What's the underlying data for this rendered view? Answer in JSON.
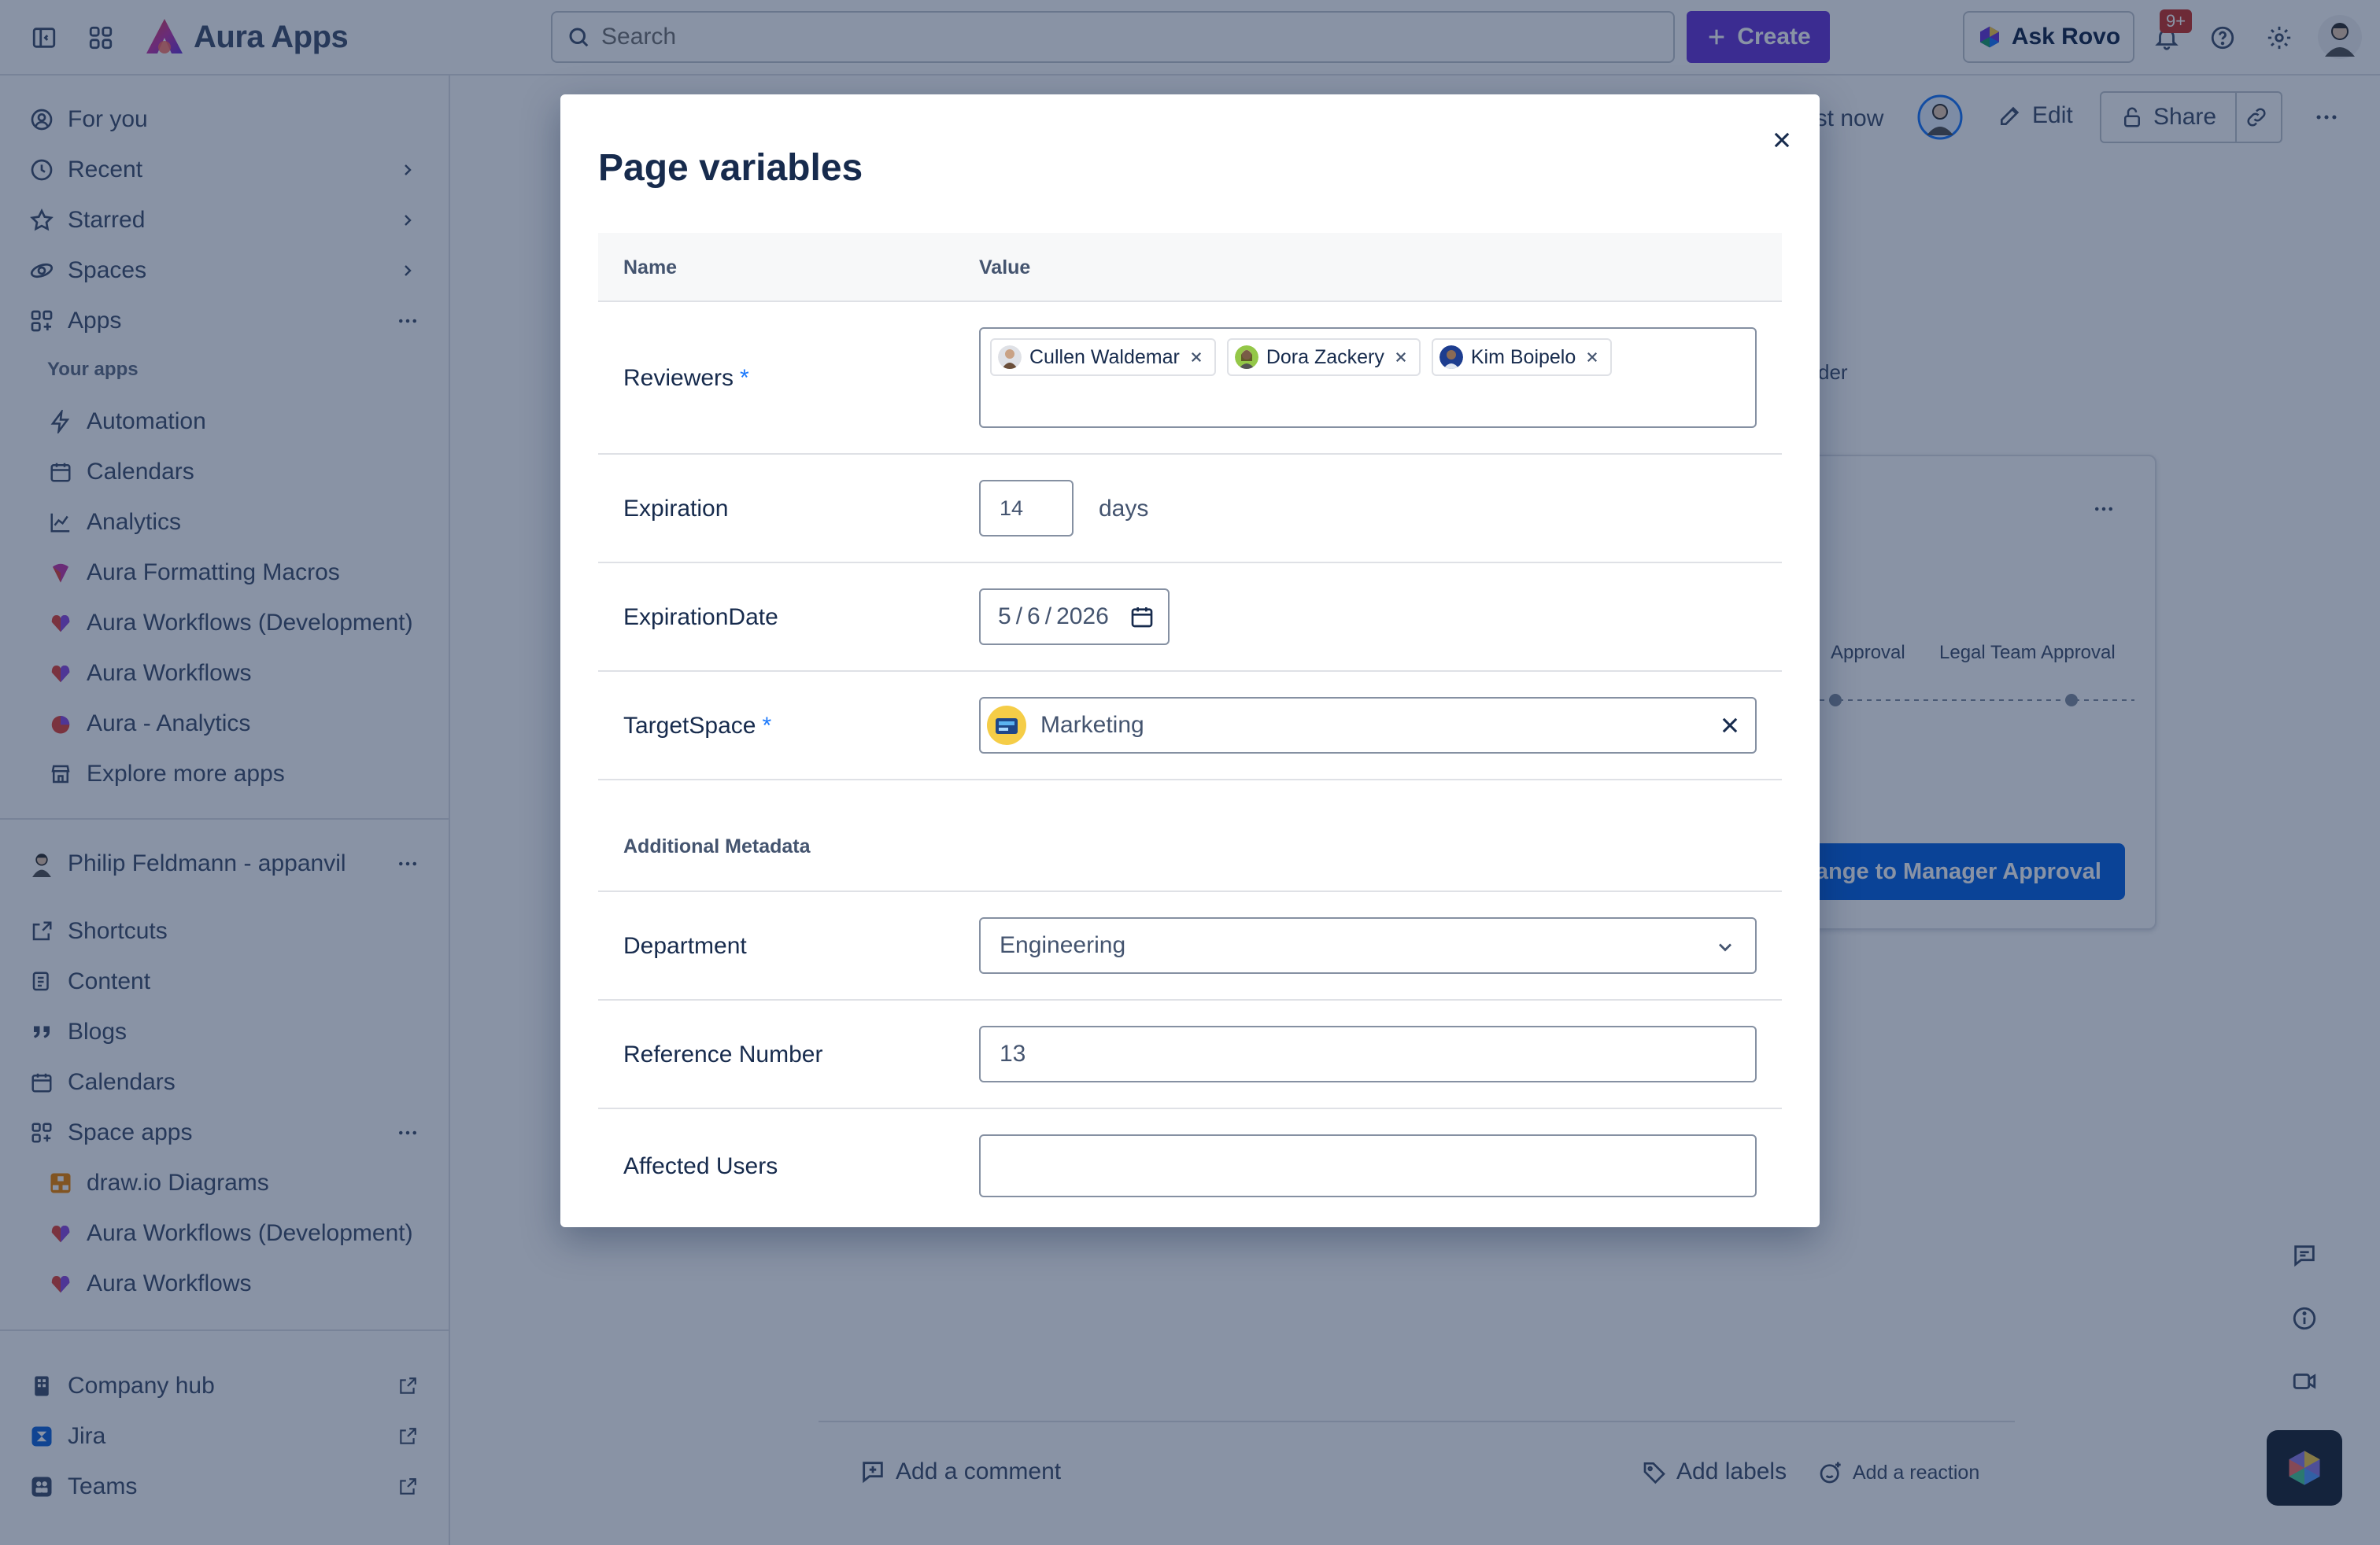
{
  "topbar": {
    "app_name": "Aura Apps",
    "search_placeholder": "Search",
    "create_label": "Create",
    "ask_rovo_label": "Ask Rovo",
    "notifications_badge": "9+"
  },
  "sidebar": {
    "top_items": [
      {
        "label": "For you"
      },
      {
        "label": "Recent"
      },
      {
        "label": "Starred"
      },
      {
        "label": "Spaces"
      },
      {
        "label": "Apps"
      }
    ],
    "your_apps_label": "Your apps",
    "apps": [
      {
        "label": "Automation"
      },
      {
        "label": "Calendars"
      },
      {
        "label": "Analytics"
      },
      {
        "label": "Aura Formatting Macros"
      },
      {
        "label": "Aura Workflows (Development)"
      },
      {
        "label": "Aura Workflows"
      },
      {
        "label": "Aura - Analytics"
      },
      {
        "label": "Explore more apps"
      }
    ],
    "space_name": "Philip Feldmann - appanvil",
    "space_items": [
      {
        "label": "Shortcuts"
      },
      {
        "label": "Content"
      },
      {
        "label": "Blogs"
      },
      {
        "label": "Calendars"
      },
      {
        "label": "Space apps"
      }
    ],
    "space_apps": [
      {
        "label": "draw.io Diagrams"
      },
      {
        "label": "Aura Workflows (Development)"
      },
      {
        "label": "Aura Workflows"
      }
    ],
    "external": [
      {
        "label": "Company hub"
      },
      {
        "label": "Jira"
      },
      {
        "label": "Teams"
      }
    ]
  },
  "page": {
    "updated": "ust now",
    "edit_label": "Edit",
    "share_label": "Share",
    "partial_text": "der",
    "workflow": {
      "step_a": "Approval",
      "step_b": "Legal Team Approval",
      "button": "ange to Manager Approval"
    },
    "add_comment": "Add a comment",
    "add_labels": "Add labels",
    "add_reaction": "Add a reaction"
  },
  "modal": {
    "title": "Page variables",
    "col_name": "Name",
    "col_value": "Value",
    "reviewers_label": "Reviewers",
    "required_mark": "*",
    "reviewers": [
      {
        "name": "Cullen Waldemar"
      },
      {
        "name": "Dora Zackery"
      },
      {
        "name": "Kim Boipelo"
      }
    ],
    "expiration_label": "Expiration",
    "expiration_value": "14",
    "expiration_unit": "days",
    "expiration_date_label": "ExpirationDate",
    "date": {
      "month": "5",
      "day": "6",
      "year": "2026",
      "sep": "/"
    },
    "target_space_label": "TargetSpace",
    "target_space_value": "Marketing",
    "additional_metadata_label": "Additional Metadata",
    "department_label": "Department",
    "department_value": "Engineering",
    "reference_number_label": "Reference Number",
    "reference_number_value": "13",
    "affected_users_label": "Affected Users",
    "affected_users_value": ""
  },
  "colors": {
    "accent": "#6a3bd8",
    "primary_blue": "#0c66e4",
    "required": "#1d7afc",
    "badge": "#c9372c"
  }
}
